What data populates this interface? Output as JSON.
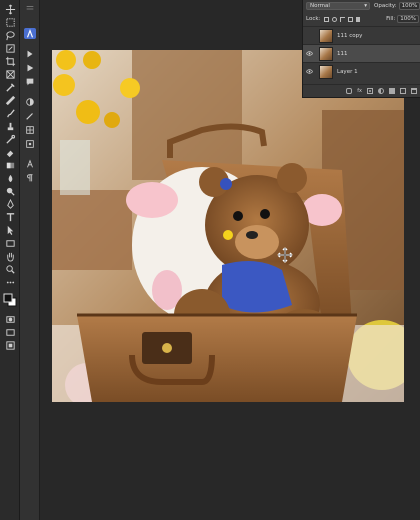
{
  "layers_panel": {
    "blend_mode": "Normal",
    "opacity_label": "Opacity:",
    "opacity_value": "100%",
    "lock_label": "Lock:",
    "fill_label": "Fill:",
    "fill_value": "100%",
    "layers": [
      {
        "name": "111 copy",
        "visible": false,
        "selected": false
      },
      {
        "name": "111",
        "visible": true,
        "selected": true
      },
      {
        "name": "Layer 1",
        "visible": true,
        "selected": false
      }
    ],
    "bottom_icons": [
      "link-icon",
      "fx-icon",
      "mask-icon",
      "adjustment-icon",
      "group-icon",
      "new-layer-icon",
      "trash-icon"
    ]
  },
  "toolbar": {
    "tools": [
      "move-tool",
      "artboard-tool",
      "lasso-tool",
      "magic-select-tool",
      "crop-tool",
      "frame-tool",
      "eyedropper-tool",
      "healing-tool",
      "brush-tool",
      "stamp-tool",
      "history-brush-tool",
      "eraser-tool",
      "gradient-tool",
      "blur-tool",
      "dodge-tool",
      "pen-tool",
      "type-tool",
      "path-select-tool",
      "shape-tool",
      "hand-tool",
      "zoom-tool",
      "more-tools",
      "colors",
      "quick-mask",
      "screen-mode",
      "frame-toggle"
    ]
  },
  "colors": {
    "ui_dark": "#282828",
    "panel": "#383838",
    "accent": "#4a6fd1"
  }
}
